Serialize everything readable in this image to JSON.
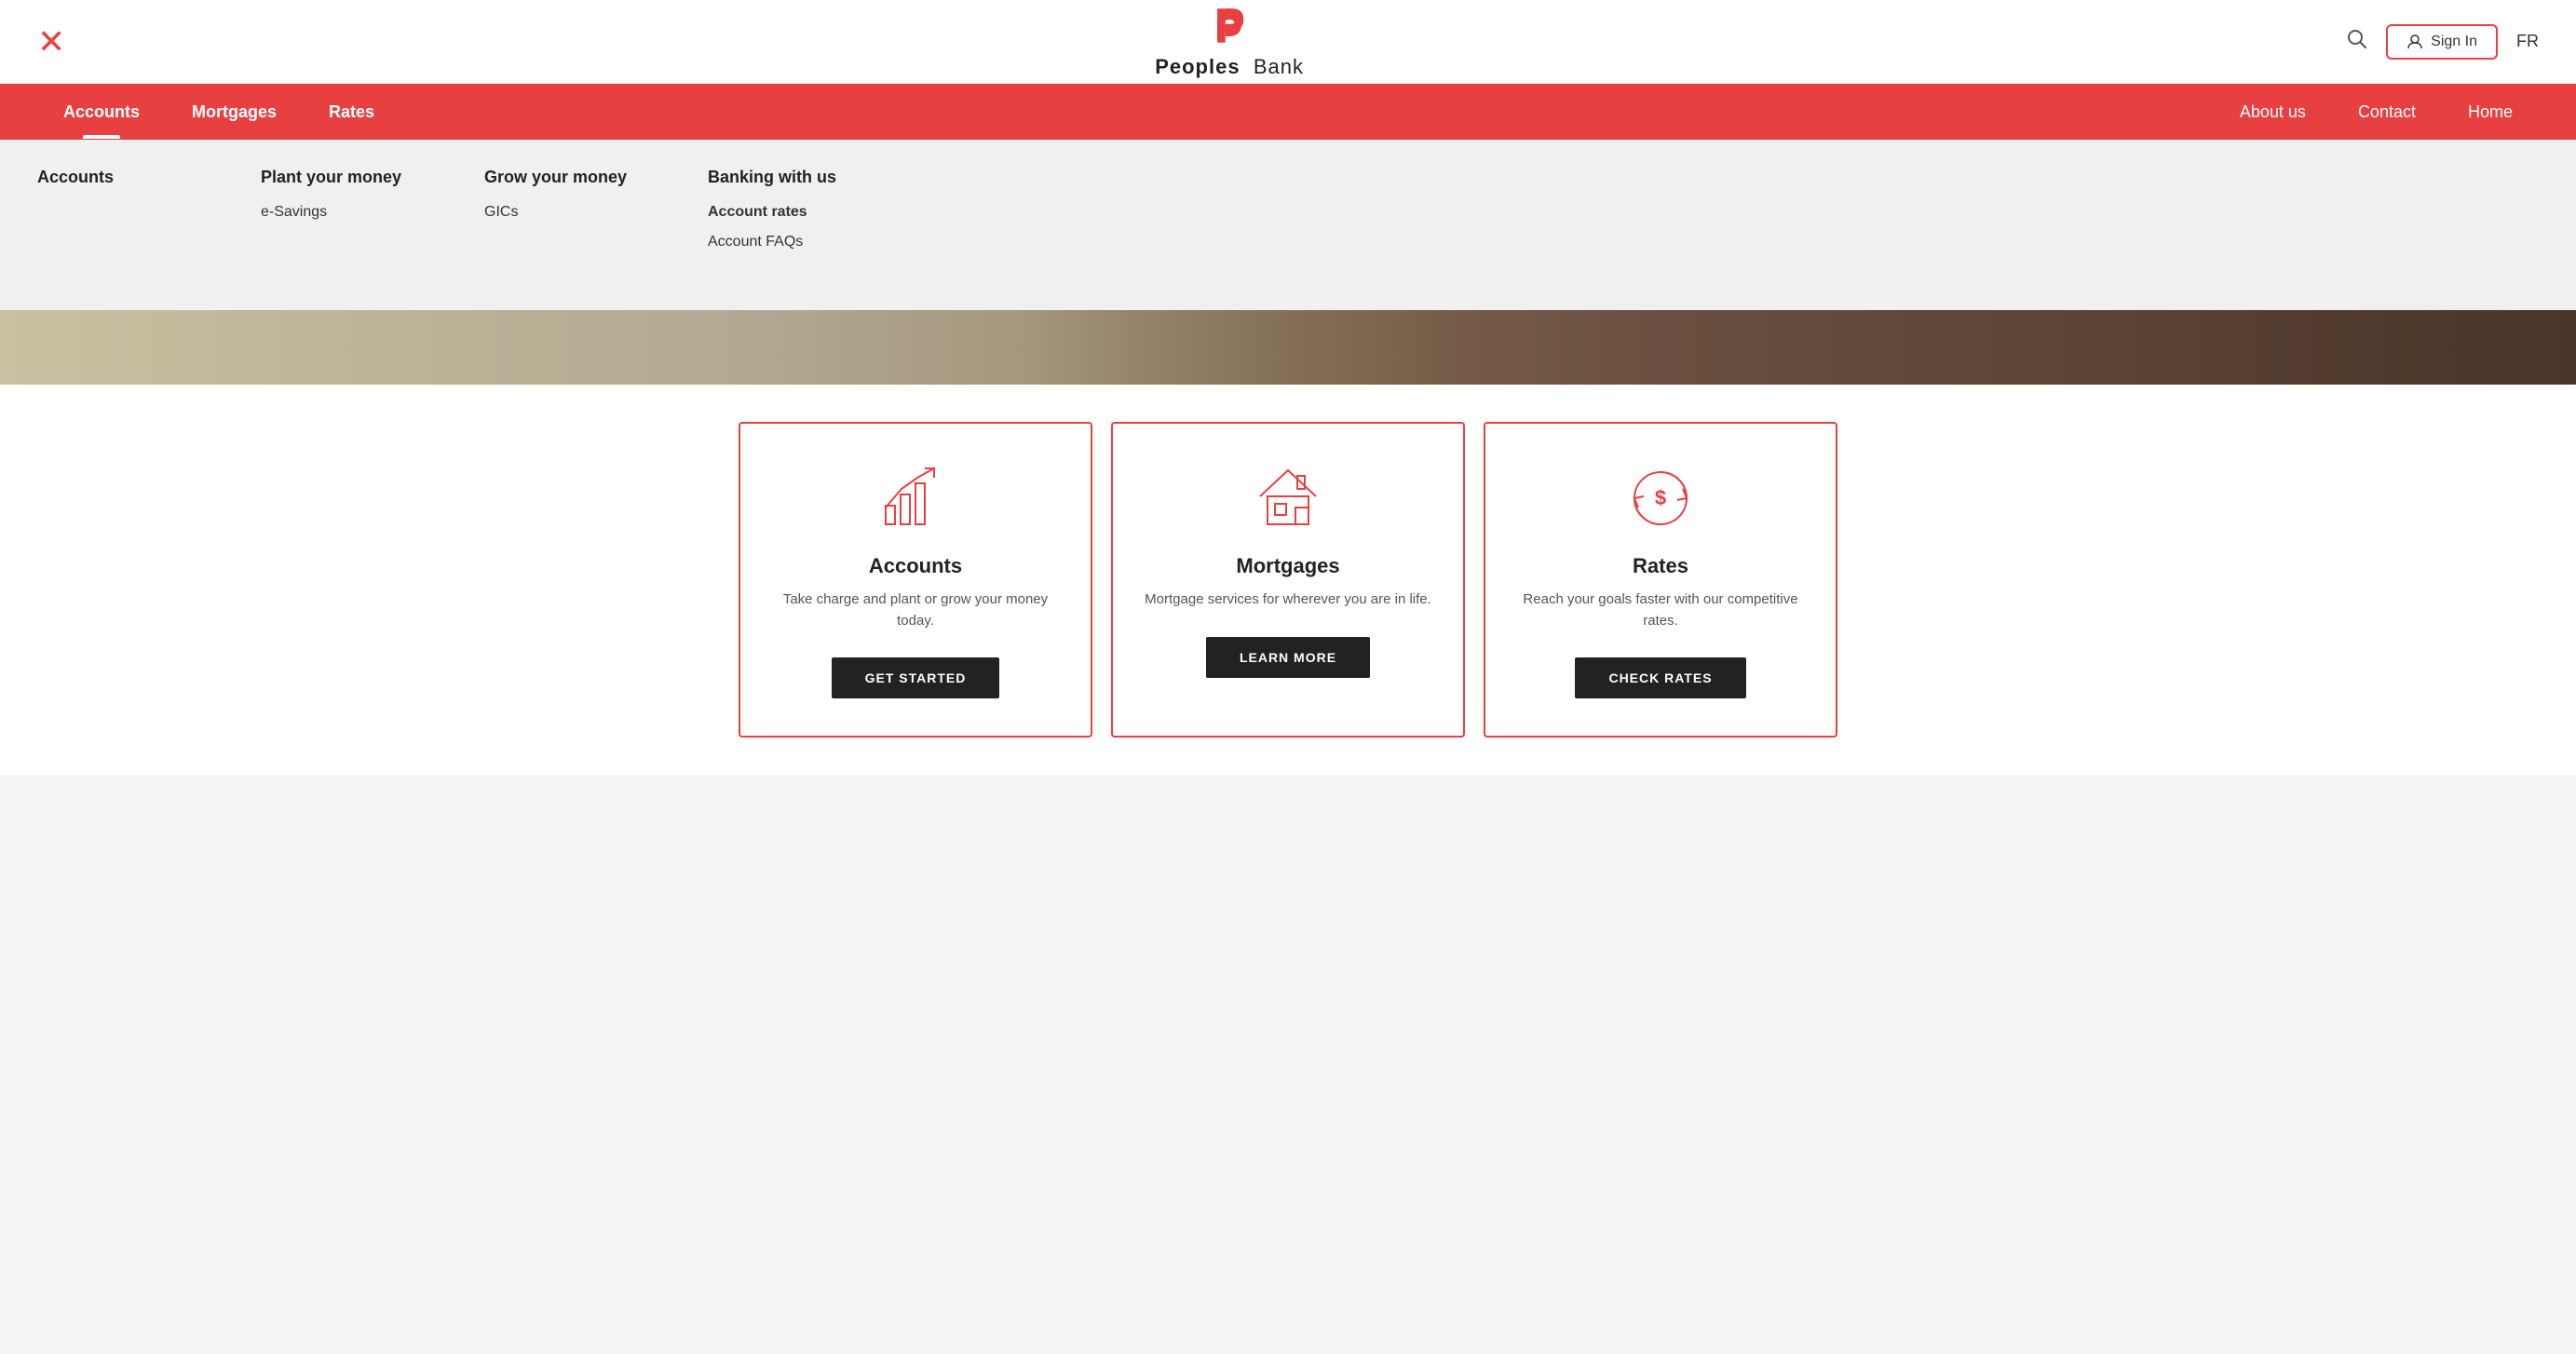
{
  "header": {
    "logo_name": "Peoples Bank",
    "logo_name_bold": "Peoples",
    "logo_name_light": "Bank",
    "signin_label": "Sign In",
    "lang_label": "FR"
  },
  "navbar": {
    "left_items": [
      {
        "label": "Accounts",
        "active": true
      },
      {
        "label": "Mortgages",
        "active": false
      },
      {
        "label": "Rates",
        "active": false
      }
    ],
    "right_items": [
      {
        "label": "About us"
      },
      {
        "label": "Contact"
      },
      {
        "label": "Home"
      }
    ]
  },
  "dropdown": {
    "columns": [
      {
        "title": "Accounts",
        "items": []
      },
      {
        "title": "Plant your money",
        "items": [
          {
            "label": "e-Savings",
            "bold": false
          }
        ]
      },
      {
        "title": "Grow your money",
        "items": [
          {
            "label": "GICs",
            "bold": false
          }
        ]
      },
      {
        "title": "Banking with us",
        "items": [
          {
            "label": "Account rates",
            "bold": true
          },
          {
            "label": "Account FAQs",
            "bold": false
          }
        ]
      }
    ]
  },
  "cards": [
    {
      "id": "accounts",
      "title": "Accounts",
      "description": "Take charge and plant or grow your money today.",
      "button_label": "GET STARTED",
      "icon": "chart"
    },
    {
      "id": "mortgages",
      "title": "Mortgages",
      "description": "Mortgage services for wherever you are in life.",
      "button_label": "LEARN MORE",
      "icon": "house"
    },
    {
      "id": "rates",
      "title": "Rates",
      "description": "Reach your goals faster with our competitive rates.",
      "button_label": "CHECK RATES",
      "icon": "dollar-cycle"
    }
  ]
}
